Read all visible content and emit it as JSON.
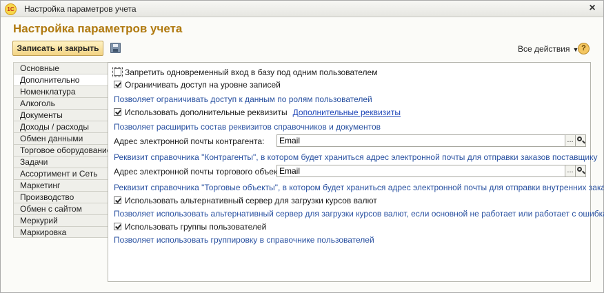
{
  "window": {
    "title": "Настройка параметров учета",
    "close_glyph": "×",
    "logo_text": "1С"
  },
  "form": {
    "title": "Настройка параметров учета"
  },
  "toolbar": {
    "save_close_label": "Записать и закрыть",
    "all_actions_label": "Все действия",
    "help_glyph": "?"
  },
  "tabs": [
    {
      "label": "Основные"
    },
    {
      "label": "Дополнительно"
    },
    {
      "label": "Номенклатура"
    },
    {
      "label": "Алкоголь"
    },
    {
      "label": "Документы"
    },
    {
      "label": "Доходы / расходы"
    },
    {
      "label": "Обмен данными"
    },
    {
      "label": "Торговое оборудование"
    },
    {
      "label": "Задачи"
    },
    {
      "label": "Ассортимент и Сеть"
    },
    {
      "label": "Маркетинг"
    },
    {
      "label": "Производство"
    },
    {
      "label": "Обмен с сайтом"
    },
    {
      "label": "Меркурий"
    },
    {
      "label": "Маркировка"
    }
  ],
  "active_tab": "Дополнительно",
  "settings": {
    "single_user_login": {
      "label": "Запретить одновременный вход в базу под одним пользователем",
      "checked": false
    },
    "record_level_access": {
      "label": "Ограничивать доступ на уровне записей",
      "checked": true,
      "hint": "Позволяет ограничивать доступ к данным по ролям пользователей"
    },
    "additional_attributes": {
      "label": "Использовать дополнительные реквизиты",
      "checked": true,
      "link": "Дополнительные реквизиты",
      "hint": "Позволяет расширить состав реквизитов справочников и документов"
    },
    "counterparty_email": {
      "label": "Адрес электронной почты контрагента:",
      "value": "Email",
      "hint": "Реквизит справочника \"Контрагенты\", в котором будет храниться адрес электронной почты для отправки заказов поставщику"
    },
    "store_email": {
      "label": "Адрес электронной почты торгового объекта:",
      "value": "Email",
      "hint": "Реквизит справочника \"Торговые объекты\", в котором будет храниться адрес электронной почты для отправки внутренних заказов"
    },
    "alt_currency_server": {
      "label": "Использовать альтернативный сервер для загрузки курсов валют",
      "checked": true,
      "hint": "Позволяет использовать альтернативный сервер для загрузки курсов валют, если основной не работает или работает с ошибками"
    },
    "user_groups": {
      "label": "Использовать группы пользователей",
      "checked": true,
      "hint": "Позволяет использовать группировку в справочнике пользователей"
    }
  },
  "choice_button_glyph": "...",
  "colors": {
    "title_accent": "#b07a10",
    "hint_text": "#2850a0",
    "link": "#1f46b8",
    "save_button": "#f2d383"
  }
}
